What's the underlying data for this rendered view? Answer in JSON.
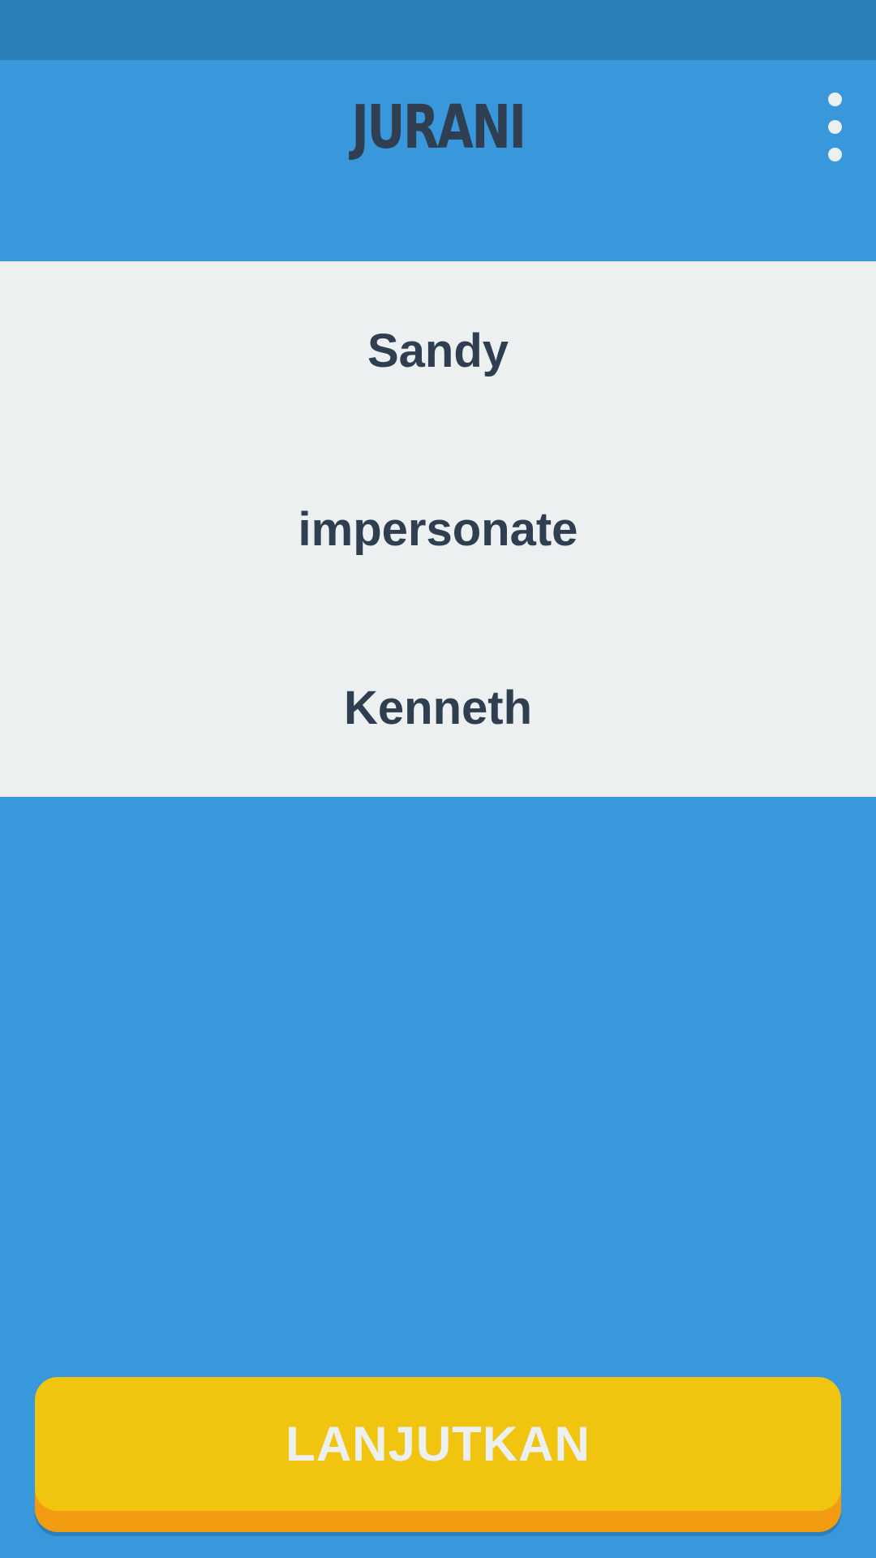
{
  "app": {
    "title": "JURANI",
    "menu_icon": "more-vertical-icon"
  },
  "options": [
    {
      "label": "Sandy"
    },
    {
      "label": "impersonate"
    },
    {
      "label": "Kenneth"
    }
  ],
  "footer": {
    "continue_label": "LANJUTKAN"
  },
  "colors": {
    "primary_blue": "#3898db",
    "status_bar": "#2b80b9",
    "panel_bg": "#ecf0f1",
    "text_dark": "#2f3e51",
    "button_yellow": "#f1c40f",
    "button_shadow": "#f39c12"
  }
}
